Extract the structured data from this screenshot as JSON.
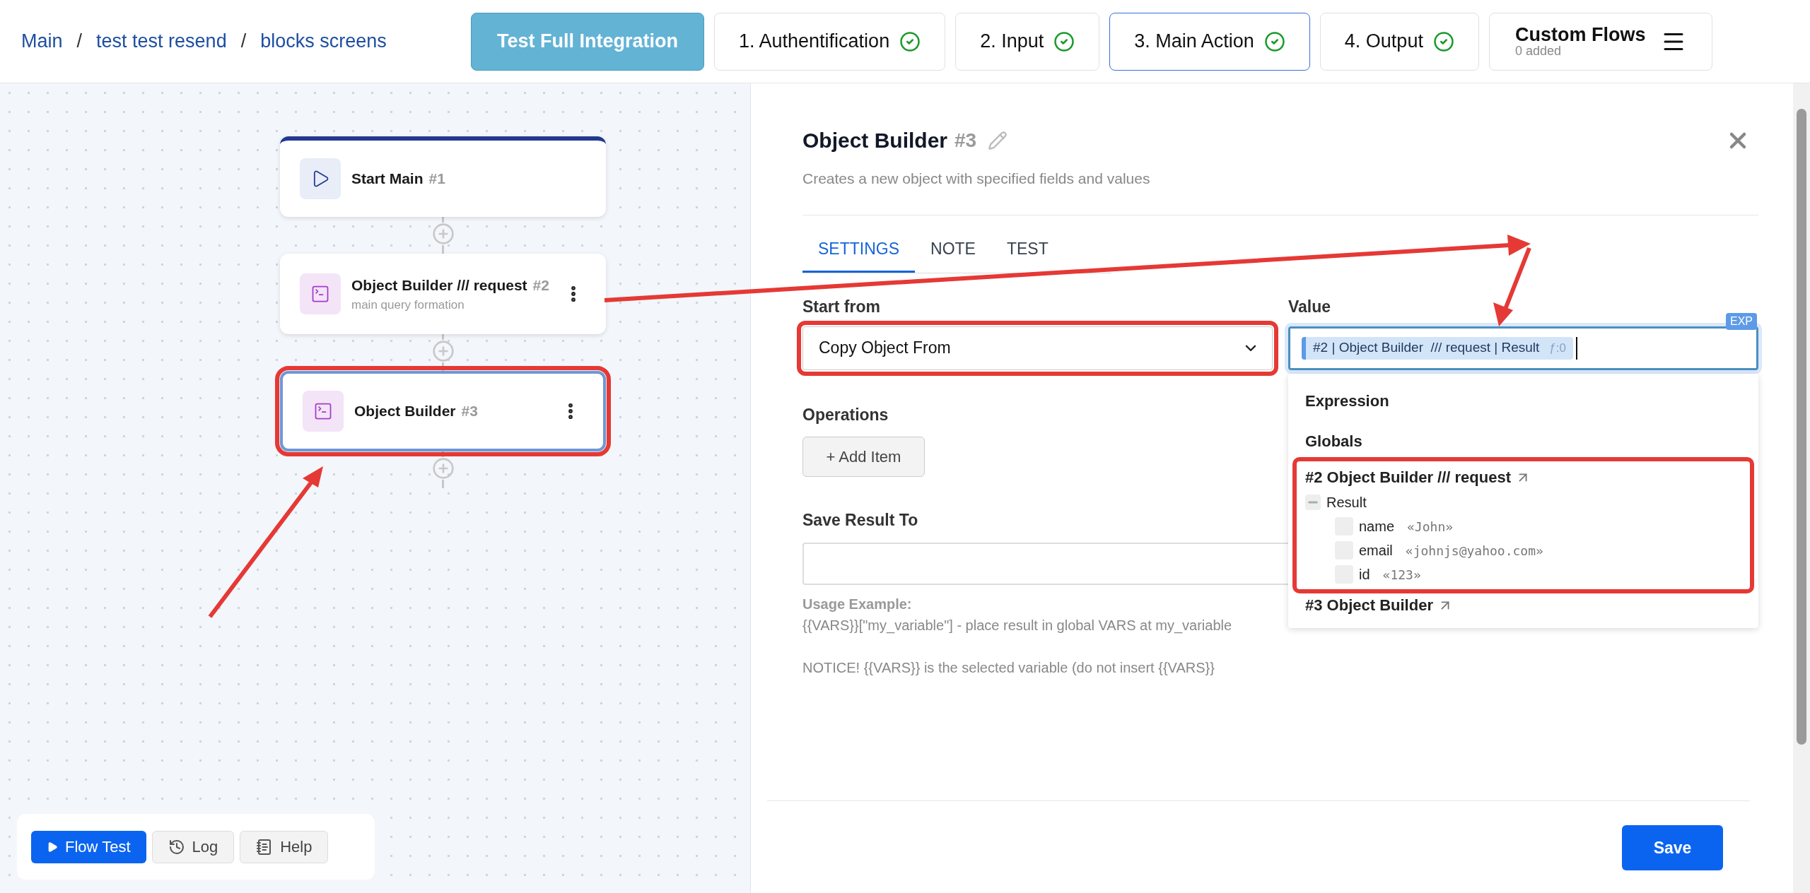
{
  "breadcrumb": [
    "Main",
    "test test resend",
    "blocks screens"
  ],
  "breadcrumb_separators": [
    "/",
    "/"
  ],
  "integration_button": {
    "label": "Test Full Integration"
  },
  "steps": [
    {
      "label": "1. Authentification",
      "done": true,
      "selected": false
    },
    {
      "label": "2. Input",
      "done": true,
      "selected": false
    },
    {
      "label": "3. Main Action",
      "done": true,
      "selected": true
    },
    {
      "label": "4. Output",
      "done": true,
      "selected": false
    }
  ],
  "custom_flows": {
    "label": "Custom Flows",
    "count": "0 added"
  },
  "nodes": [
    {
      "kind": "start",
      "title": "Start Main",
      "number": "#1",
      "selected": false,
      "highlighted": false
    },
    {
      "kind": "object",
      "title": "Object Builder /// request",
      "number": "#2",
      "subtitle": "main query formation",
      "selected": false,
      "highlighted": false
    },
    {
      "kind": "object",
      "title": "Object Builder",
      "number": "#3",
      "selected": true,
      "highlighted": true
    }
  ],
  "toolbar": [
    {
      "kind": "run",
      "label": "Flow Test"
    },
    {
      "kind": "log",
      "label": "Log"
    },
    {
      "kind": "help",
      "label": "Help"
    }
  ],
  "panel": {
    "title": "Object Builder",
    "number": "#3",
    "description": "Creates a new object with specified fields and values",
    "tabs": [
      {
        "label": "SETTINGS",
        "selected": true
      },
      {
        "label": "NOTE",
        "selected": false
      },
      {
        "label": "TEST",
        "selected": false
      }
    ],
    "start_from": {
      "label": "Start from",
      "value": "Copy Object From",
      "highlighted": true
    },
    "value": {
      "label": "Value",
      "badge": "EXP",
      "token": "#2 | Object Builder  /// request | Result",
      "token_suffix": "ƒ:0"
    },
    "suggestions": [
      {
        "kind": "heading",
        "label": "Expression"
      },
      {
        "kind": "heading",
        "label": "Globals"
      },
      {
        "kind": "block",
        "label": "#2 Object Builder /// request",
        "highlighted": true,
        "children": [
          {
            "label": "Result",
            "expanded": true,
            "children": [
              {
                "label": "name",
                "value": "«John»"
              },
              {
                "label": "email",
                "value": "«johnjs@yahoo.com»"
              },
              {
                "label": "id",
                "value": "«123»"
              }
            ]
          }
        ]
      },
      {
        "kind": "block",
        "label": "#3 Object Builder",
        "highlighted": false
      }
    ],
    "operations": {
      "label": "Operations",
      "button": "+ Add Item"
    },
    "save_result": {
      "label": "Save Result To"
    },
    "usage_title": "Usage Example:",
    "usage_text": "{{VARS}}[\"my_variable\"] - place result in global VARS at my_variable",
    "notice": "NOTICE! {{VARS}} is the selected variable (do not insert {{VARS}}",
    "save_button": "Save"
  }
}
